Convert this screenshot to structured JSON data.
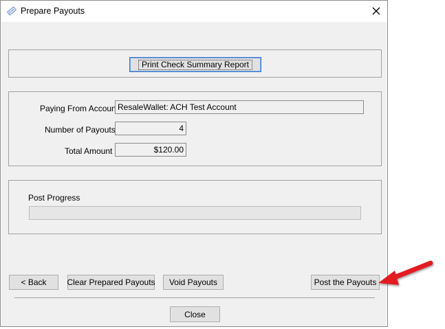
{
  "window": {
    "title": "Prepare Payouts"
  },
  "report": {
    "print_button_label": "Print Check Summary Report"
  },
  "summary": {
    "paying_from_label": "Paying From Account",
    "paying_from_value": "ResaleWallet: ACH Test Account",
    "num_payouts_label": "Number of Payouts",
    "num_payouts_value": "4",
    "total_amount_label": "Total Amount",
    "total_amount_value": "$120.00"
  },
  "progress": {
    "label": "Post Progress",
    "value": 0
  },
  "actions": {
    "back_label": "< Back",
    "clear_label": "Clear Prepared Payouts",
    "void_label": "Void Payouts",
    "post_label": "Post the Payouts",
    "close_label": "Close"
  },
  "colors": {
    "annotation_arrow": "#e31b23",
    "dialog_background": "#f0f0f0",
    "focus_border": "#3a78c9"
  },
  "icons": {
    "title": "payout-tag-icon",
    "close": "close-icon",
    "annotation": "red-arrow-icon"
  }
}
